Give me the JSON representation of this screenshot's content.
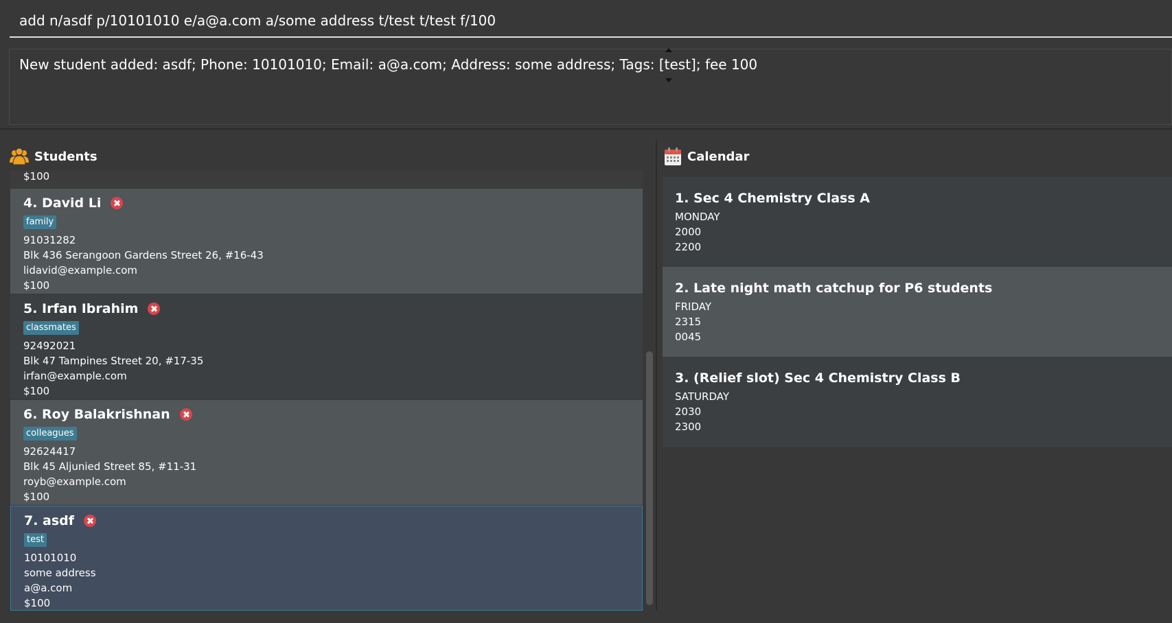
{
  "command": {
    "input_value": "add n/asdf p/10101010 e/a@a.com a/some address t/test t/test f/100"
  },
  "result": {
    "message": "New student added: asdf; Phone: 10101010; Email: a@a.com; Address: some address; Tags: [test]; fee 100"
  },
  "students_panel": {
    "title": "Students",
    "icon": "students-group-icon",
    "partial_fee": "$100",
    "items": [
      {
        "name": "4. David Li",
        "tag": "family",
        "phone": "91031282",
        "address": "Blk 436 Serangoon Gardens Street 26, #16-43",
        "email": "lidavid@example.com",
        "fee": "$100"
      },
      {
        "name": "5. Irfan Ibrahim",
        "tag": "classmates",
        "phone": "92492021",
        "address": "Blk 47 Tampines Street 20, #17-35",
        "email": "irfan@example.com",
        "fee": "$100"
      },
      {
        "name": "6. Roy Balakrishnan",
        "tag": "colleagues",
        "phone": "92624417",
        "address": "Blk 45 Aljunied Street 85, #11-31",
        "email": "royb@example.com",
        "fee": "$100"
      },
      {
        "name": "7. asdf",
        "tag": "test",
        "phone": "10101010",
        "address": "some address",
        "email": "a@a.com",
        "fee": "$100"
      }
    ]
  },
  "calendar_panel": {
    "title": "Calendar",
    "icon": "calendar-icon",
    "items": [
      {
        "title": "1. Sec 4 Chemistry Class A",
        "day": "MONDAY",
        "start": "2000",
        "end": "2200"
      },
      {
        "title": "2. Late night math catchup for P6 students",
        "day": "FRIDAY",
        "start": "2315",
        "end": "0045"
      },
      {
        "title": "3. (Relief slot) Sec 4 Chemistry Class B",
        "day": "SATURDAY",
        "start": "2030",
        "end": "2300"
      }
    ]
  },
  "colors": {
    "background": "#383838",
    "card_dark": "#3c3f41",
    "card_light": "#515658",
    "card_selected": "#424d5f",
    "tag": "#3e7b91",
    "delete": "#d9454d",
    "students_icon": "#f0a020",
    "calendar_icon": "#e05545"
  }
}
